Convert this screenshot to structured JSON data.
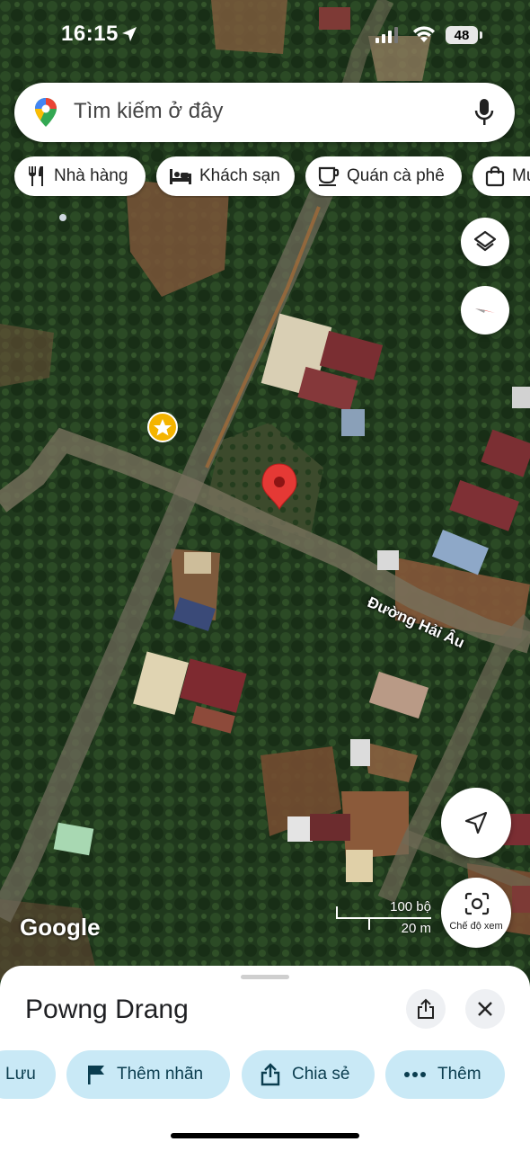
{
  "status_bar": {
    "time": "16:15",
    "battery": "48"
  },
  "search": {
    "placeholder": "Tìm kiếm ở đây"
  },
  "chips": [
    {
      "label": "Nhà hàng",
      "icon": "restaurant-icon"
    },
    {
      "label": "Khách sạn",
      "icon": "hotel-icon"
    },
    {
      "label": "Quán cà phê",
      "icon": "coffee-icon"
    },
    {
      "label": "Mu",
      "icon": "shopping-bag-icon"
    }
  ],
  "map": {
    "street_label": "Đường Hải Âu",
    "attribution": "Google",
    "scale": {
      "imperial": "100 bộ",
      "metric": "20 m"
    },
    "view_mode_label": "Chế độ xem"
  },
  "place": {
    "name": "Powng Drang",
    "actions": [
      {
        "label": "Lưu",
        "icon": "bookmark-icon"
      },
      {
        "label": "Thêm nhãn",
        "icon": "flag-icon"
      },
      {
        "label": "Chia sẻ",
        "icon": "share-icon"
      },
      {
        "label": "Thêm",
        "icon": "more-icon"
      }
    ]
  },
  "colors": {
    "accent": "#c9e9f6",
    "pin": "#e53935",
    "favorite": "#f4b400"
  }
}
